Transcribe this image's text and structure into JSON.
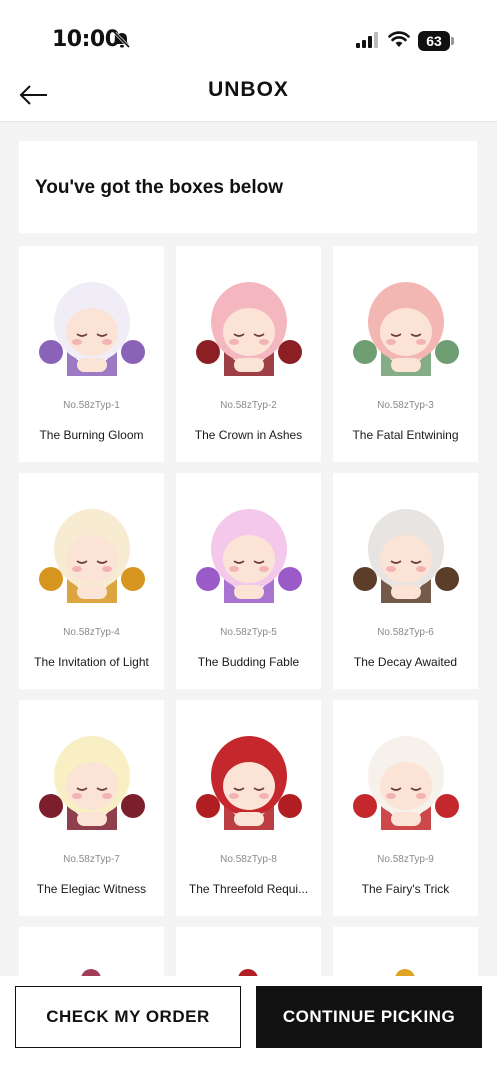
{
  "status": {
    "time": "10:00",
    "battery_percent": "63",
    "icons": [
      "bell-slash-icon",
      "signal-icon",
      "wifi-icon",
      "battery-icon"
    ]
  },
  "nav": {
    "back_icon": "arrow-left-icon",
    "title": "UNBOX"
  },
  "heading": "You've got the boxes below",
  "boxes": [
    {
      "code": "No.58zTyp-1",
      "name": "The Burning Gloom",
      "color": "#8a63b8",
      "hair": "#f1edf7"
    },
    {
      "code": "No.58zTyp-2",
      "name": "The Crown in Ashes",
      "color": "#8b1f24",
      "hair": "#f4b7c0"
    },
    {
      "code": "No.58zTyp-3",
      "name": "The Fatal Entwining",
      "color": "#6f9e72",
      "hair": "#f3b7b3"
    },
    {
      "code": "No.58zTyp-4",
      "name": "The Invitation of Light",
      "color": "#d6951e",
      "hair": "#f7ecd2"
    },
    {
      "code": "No.58zTyp-5",
      "name": "The Budding Fable",
      "color": "#9a5bc9",
      "hair": "#f3c8ea"
    },
    {
      "code": "No.58zTyp-6",
      "name": "The Decay Awaited",
      "color": "#5b3d2a",
      "hair": "#e7e4e1"
    },
    {
      "code": "No.58zTyp-7",
      "name": "The Elegiac Witness",
      "color": "#7b1f2d",
      "hair": "#f8efc5"
    },
    {
      "code": "No.58zTyp-8",
      "name": "The Threefold Requi...",
      "color": "#b01e22",
      "hair": "#c4282c"
    },
    {
      "code": "No.58zTyp-9",
      "name": "The Fairy's Trick",
      "color": "#c4282c",
      "hair": "#f6f1ea"
    }
  ],
  "peek_colors": [
    "#a23d57",
    "#b11e24",
    "#e0a321"
  ],
  "actions": {
    "check_order": "CHECK MY ORDER",
    "continue_picking": "CONTINUE PICKING"
  }
}
